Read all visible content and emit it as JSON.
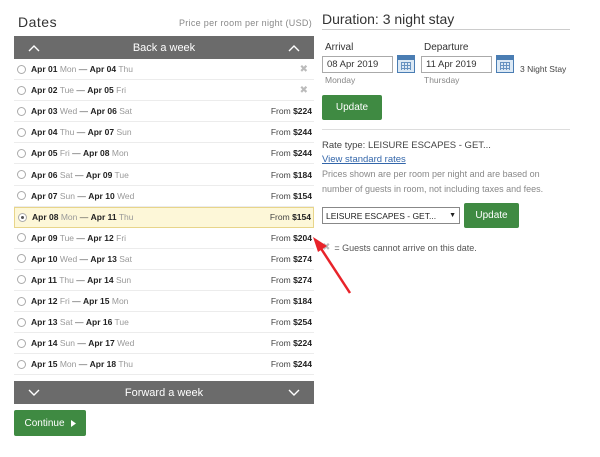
{
  "dates_panel": {
    "title": "Dates",
    "price_note": "Price per room per night (USD)",
    "back_label": "Back a week",
    "forward_label": "Forward a week",
    "rows": [
      {
        "start": "Apr 01",
        "start_dow": "Mon",
        "sep": "—",
        "end": "Apr 04",
        "end_dow": "Thu",
        "from": "",
        "price": "",
        "unavailable": true,
        "selected": false
      },
      {
        "start": "Apr 02",
        "start_dow": "Tue",
        "sep": "—",
        "end": "Apr 05",
        "end_dow": "Fri",
        "from": "",
        "price": "",
        "unavailable": true,
        "selected": false
      },
      {
        "start": "Apr 03",
        "start_dow": "Wed",
        "sep": "—",
        "end": "Apr 06",
        "end_dow": "Sat",
        "from": "From",
        "price": "$224",
        "unavailable": false,
        "selected": false
      },
      {
        "start": "Apr 04",
        "start_dow": "Thu",
        "sep": "—",
        "end": "Apr 07",
        "end_dow": "Sun",
        "from": "From",
        "price": "$244",
        "unavailable": false,
        "selected": false
      },
      {
        "start": "Apr 05",
        "start_dow": "Fri",
        "sep": "—",
        "end": "Apr 08",
        "end_dow": "Mon",
        "from": "From",
        "price": "$244",
        "unavailable": false,
        "selected": false
      },
      {
        "start": "Apr 06",
        "start_dow": "Sat",
        "sep": "—",
        "end": "Apr 09",
        "end_dow": "Tue",
        "from": "From",
        "price": "$184",
        "unavailable": false,
        "selected": false
      },
      {
        "start": "Apr 07",
        "start_dow": "Sun",
        "sep": "—",
        "end": "Apr 10",
        "end_dow": "Wed",
        "from": "From",
        "price": "$154",
        "unavailable": false,
        "selected": false
      },
      {
        "start": "Apr 08",
        "start_dow": "Mon",
        "sep": "—",
        "end": "Apr 11",
        "end_dow": "Thu",
        "from": "From",
        "price": "$154",
        "unavailable": false,
        "selected": true
      },
      {
        "start": "Apr 09",
        "start_dow": "Tue",
        "sep": "—",
        "end": "Apr 12",
        "end_dow": "Fri",
        "from": "From",
        "price": "$204",
        "unavailable": false,
        "selected": false
      },
      {
        "start": "Apr 10",
        "start_dow": "Wed",
        "sep": "—",
        "end": "Apr 13",
        "end_dow": "Sat",
        "from": "From",
        "price": "$274",
        "unavailable": false,
        "selected": false
      },
      {
        "start": "Apr 11",
        "start_dow": "Thu",
        "sep": "—",
        "end": "Apr 14",
        "end_dow": "Sun",
        "from": "From",
        "price": "$274",
        "unavailable": false,
        "selected": false
      },
      {
        "start": "Apr 12",
        "start_dow": "Fri",
        "sep": "—",
        "end": "Apr 15",
        "end_dow": "Mon",
        "from": "From",
        "price": "$184",
        "unavailable": false,
        "selected": false
      },
      {
        "start": "Apr 13",
        "start_dow": "Sat",
        "sep": "—",
        "end": "Apr 16",
        "end_dow": "Tue",
        "from": "From",
        "price": "$254",
        "unavailable": false,
        "selected": false
      },
      {
        "start": "Apr 14",
        "start_dow": "Sun",
        "sep": "—",
        "end": "Apr 17",
        "end_dow": "Wed",
        "from": "From",
        "price": "$224",
        "unavailable": false,
        "selected": false
      },
      {
        "start": "Apr 15",
        "start_dow": "Mon",
        "sep": "—",
        "end": "Apr 18",
        "end_dow": "Thu",
        "from": "From",
        "price": "$244",
        "unavailable": false,
        "selected": false
      }
    ],
    "unavailable_glyph": "✖",
    "continue_label": "Continue"
  },
  "stay_panel": {
    "title": "Duration: 3 night stay",
    "arrival_label": "Arrival",
    "arrival_value": "08 Apr 2019",
    "arrival_dow": "Monday",
    "departure_label": "Departure",
    "departure_value": "11 Apr 2019",
    "departure_dow": "Thursday",
    "stay_text": "3 Night Stay",
    "update_label": "Update",
    "rate_type": "Rate type: LEISURE ESCAPES - GET...",
    "view_rates_link": "View standard rates",
    "price_note": "Prices shown are per room per night and are based on number of guests in room, not including taxes and fees.",
    "rate_select_value": "LEISURE ESCAPES - GET...",
    "update2_label": "Update",
    "legend_text": "= Guests cannot arrive on this date."
  },
  "colors": {
    "nav_bar": "#6b6b6b",
    "button_green": "#3f8a42",
    "selected_row_bg": "#fdf7d8",
    "link_blue": "#3366aa",
    "annotation_arrow": "#e8232a"
  },
  "icons": {
    "chevron_up": "chevron-up-icon",
    "chevron_down": "chevron-down-icon",
    "calendar": "calendar-icon",
    "unavailable": "x-icon",
    "continue_arrow": "caret-right-icon"
  }
}
